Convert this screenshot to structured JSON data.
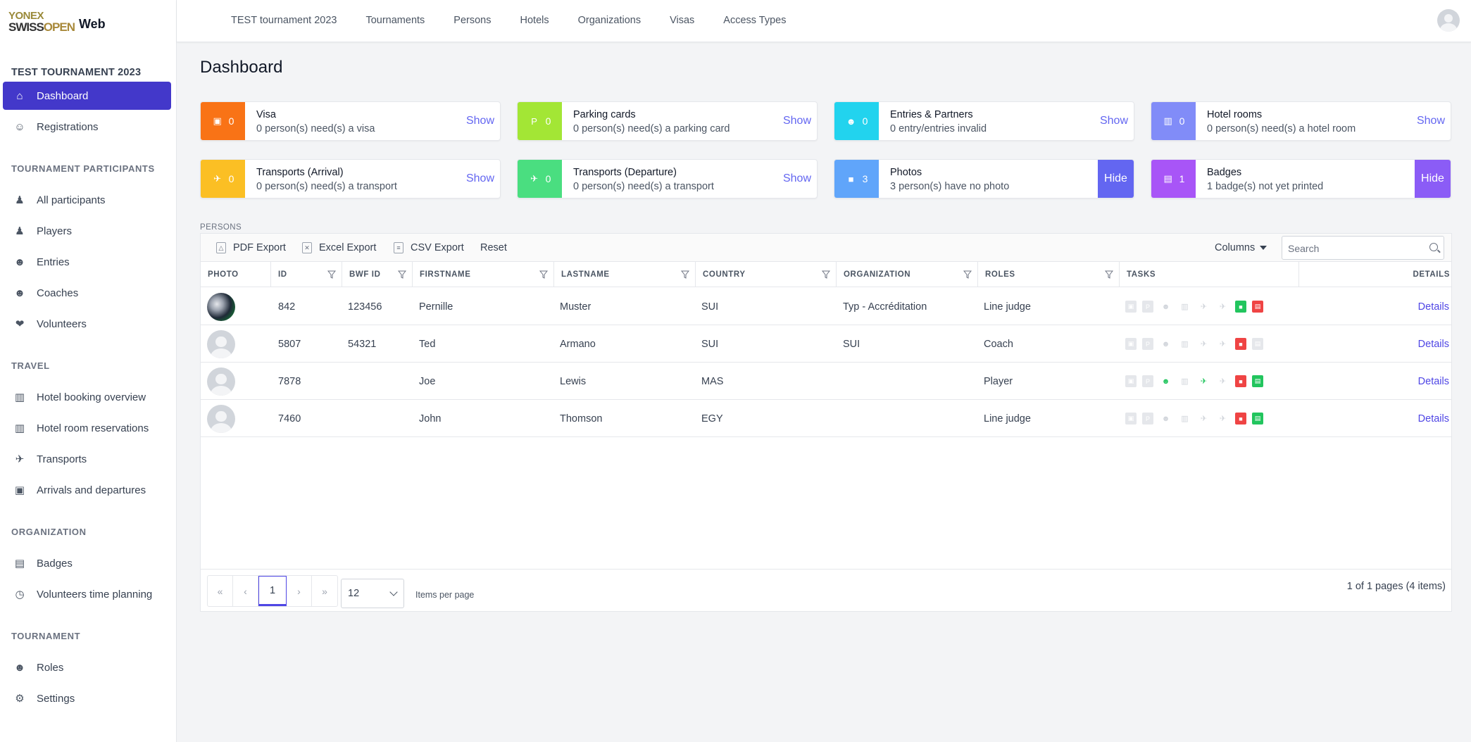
{
  "app": {
    "logo_top": "YONEX",
    "logo_bottom_a": "SWISS",
    "logo_bottom_b": "OPEN",
    "logo_suffix": "Web"
  },
  "topnav": [
    "TEST tournament 2023",
    "Tournaments",
    "Persons",
    "Hotels",
    "Organizations",
    "Visas",
    "Access Types"
  ],
  "sidebar": {
    "tournament_title": "TEST TOURNAMENT 2023",
    "main_items": [
      {
        "label": "Dashboard",
        "icon": "home-icon",
        "active": true
      },
      {
        "label": "Registrations",
        "icon": "user-plus-icon"
      }
    ],
    "participants_title": "TOURNAMENT PARTICIPANTS",
    "participants_items": [
      {
        "label": "All participants",
        "icon": "person-icon"
      },
      {
        "label": "Players",
        "icon": "player-icon"
      },
      {
        "label": "Entries",
        "icon": "users-icon"
      },
      {
        "label": "Coaches",
        "icon": "user-icon"
      },
      {
        "label": "Volunteers",
        "icon": "hand-heart-icon"
      }
    ],
    "travel_title": "TRAVEL",
    "travel_items": [
      {
        "label": "Hotel booking overview",
        "icon": "hotel-icon"
      },
      {
        "label": "Hotel room reservations",
        "icon": "hotel-icon"
      },
      {
        "label": "Transports",
        "icon": "plane-icon"
      },
      {
        "label": "Arrivals and departures",
        "icon": "badge-icon"
      }
    ],
    "organization_title": "ORGANIZATION",
    "organization_items": [
      {
        "label": "Badges",
        "icon": "id-card-icon"
      },
      {
        "label": "Volunteers time planning",
        "icon": "clock-icon"
      }
    ],
    "tournament_title2": "TOURNAMENT",
    "tournament_items": [
      {
        "label": "Roles",
        "icon": "user-gear-icon"
      },
      {
        "label": "Settings",
        "icon": "gear-icon"
      }
    ]
  },
  "page": {
    "title": "Dashboard",
    "persons_label": "PERSONS"
  },
  "cards": [
    {
      "count": "0",
      "title": "Visa",
      "subtitle": "0 person(s) need(s) a visa",
      "action": "Show",
      "color": "#f97316",
      "icon": "passport-icon"
    },
    {
      "count": "0",
      "title": "Parking cards",
      "subtitle": "0 person(s) need(s) a parking card",
      "action": "Show",
      "color": "#a3e635",
      "icon": "parking-icon"
    },
    {
      "count": "0",
      "title": "Entries & Partners",
      "subtitle": "0 entry/entries invalid",
      "action": "Show",
      "color": "#22d3ee",
      "icon": "users-icon"
    },
    {
      "count": "0",
      "title": "Hotel rooms",
      "subtitle": "0 person(s) need(s) a hotel room",
      "action": "Show",
      "color": "#818cf8",
      "icon": "hotel-icon"
    },
    {
      "count": "0",
      "title": "Transports (Arrival)",
      "subtitle": "0 person(s) need(s) a transport",
      "action": "Show",
      "color": "#fbbf24",
      "icon": "plane-arrival-icon"
    },
    {
      "count": "0",
      "title": "Transports (Departure)",
      "subtitle": "0 person(s) need(s) a transport",
      "action": "Show",
      "color": "#4ade80",
      "icon": "plane-departure-icon"
    },
    {
      "count": "3",
      "title": "Photos",
      "subtitle": "3 person(s) have no photo",
      "action": "Hide",
      "color": "#60a5fa",
      "action_color": "#6366f1",
      "icon": "portrait-icon"
    },
    {
      "count": "1",
      "title": "Badges",
      "subtitle": "1 badge(s) not yet printed",
      "action": "Hide",
      "color": "#a855f7",
      "action_color": "#8b5cf6",
      "icon": "id-card-icon"
    }
  ],
  "toolbar": {
    "pdf": "PDF Export",
    "excel": "Excel Export",
    "csv": "CSV Export",
    "reset": "Reset",
    "columns": "Columns",
    "search_placeholder": "Search"
  },
  "table": {
    "headers": [
      "PHOTO",
      "ID",
      "BWF ID",
      "FIRSTNAME",
      "LASTNAME",
      "COUNTRY",
      "ORGANIZATION",
      "ROLES",
      "TASKS",
      "DETAILS"
    ],
    "rows": [
      {
        "photo": true,
        "id": "842",
        "bwf_id": "123456",
        "firstname": "Pernille",
        "lastname": "Muster",
        "country": "SUI",
        "organization": "Typ - Accréditation",
        "roles": "Line judge",
        "details": "Details",
        "tasks": [
          "",
          "",
          "",
          "",
          "",
          "",
          "g",
          "r"
        ]
      },
      {
        "photo": false,
        "id": "5807",
        "bwf_id": "54321",
        "firstname": "Ted",
        "lastname": "Armano",
        "country": "SUI",
        "organization": "SUI",
        "roles": "Coach",
        "details": "Details",
        "tasks": [
          "",
          "",
          "",
          "",
          "",
          "",
          "r",
          ""
        ]
      },
      {
        "photo": false,
        "id": "7878",
        "bwf_id": "",
        "firstname": "Joe",
        "lastname": "Lewis",
        "country": "MAS",
        "organization": "",
        "roles": "Player",
        "details": "Details",
        "tasks": [
          "",
          "",
          "g",
          "",
          "g",
          "",
          "r",
          "g"
        ]
      },
      {
        "photo": false,
        "id": "7460",
        "bwf_id": "",
        "firstname": "John",
        "lastname": "Thomson",
        "country": "EGY",
        "organization": "",
        "roles": "Line judge",
        "details": "Details",
        "tasks": [
          "",
          "",
          "",
          "",
          "",
          "",
          "r",
          "g"
        ]
      }
    ]
  },
  "pager": {
    "first": "«",
    "prev": "‹",
    "current": "1",
    "next": "›",
    "last": "»",
    "page_size": "12",
    "items_per_page": "Items per page",
    "info": "1 of 1 pages (4 items)"
  }
}
